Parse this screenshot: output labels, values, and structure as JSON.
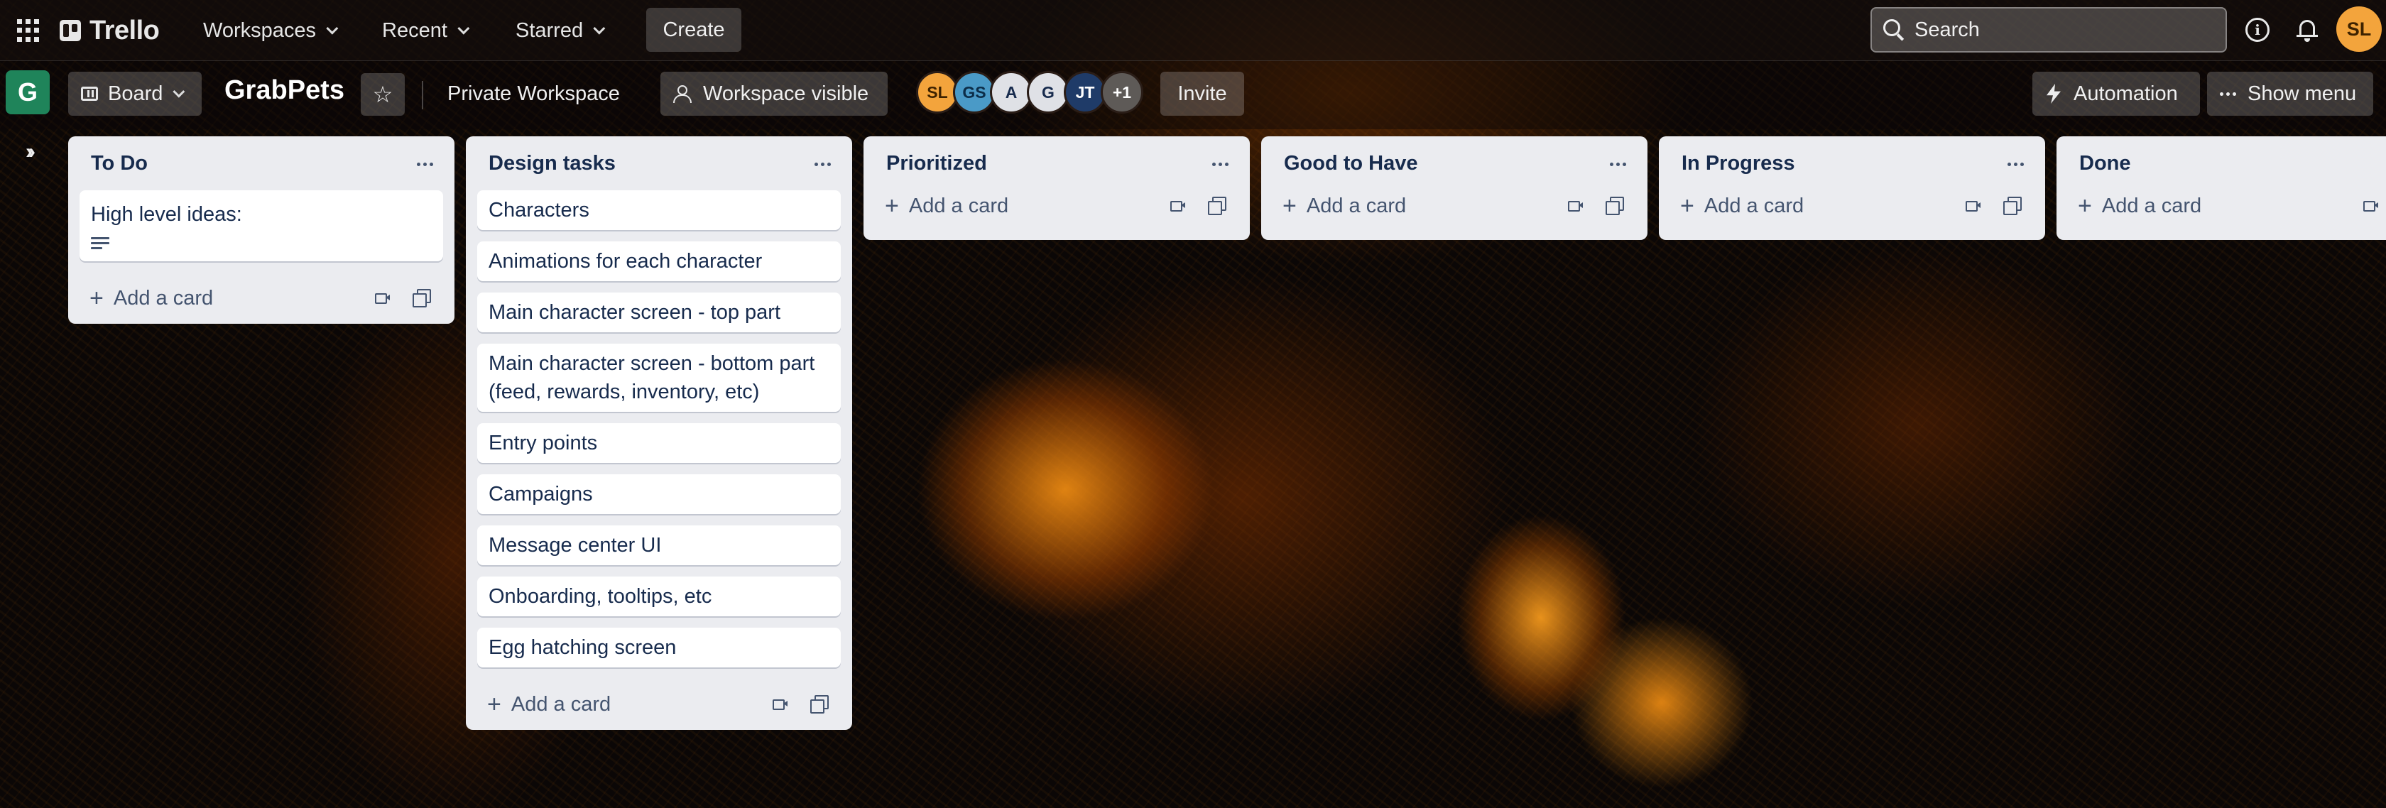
{
  "topbar": {
    "logo": "Trello",
    "nav": [
      "Workspaces",
      "Recent",
      "Starred"
    ],
    "create": "Create",
    "search_placeholder": "Search",
    "user_initials": "SL"
  },
  "board": {
    "workspace_initial": "G",
    "view": "Board",
    "title": "GrabPets",
    "workspace_label": "Private Workspace",
    "visibility": "Workspace visible",
    "members": [
      {
        "initials": "SL",
        "color": "#f3a43c",
        "text": "#3d2200"
      },
      {
        "initials": "GS",
        "color": "#4a9ac7",
        "text": "#0c2d48"
      },
      {
        "initials": "A",
        "color": "#dfe1e6",
        "text": "#172b4d"
      },
      {
        "initials": "G",
        "color": "#dfe1e6",
        "text": "#172b4d"
      },
      {
        "initials": "JT",
        "color": "#1f3b68",
        "text": "#ffffff"
      },
      {
        "initials": "+1",
        "color": "#5e5a57",
        "text": "#ffffff"
      }
    ],
    "invite": "Invite",
    "automation": "Automation",
    "show_menu": "Show menu"
  },
  "lists": [
    {
      "title": "To Do",
      "cards": [
        {
          "text": "High level ideas:",
          "has_description": true
        }
      ],
      "add_label": "Add a card"
    },
    {
      "title": "Design tasks",
      "cards": [
        {
          "text": "Characters"
        },
        {
          "text": "Animations for each character"
        },
        {
          "text": "Main character screen - top part"
        },
        {
          "text": "Main character screen - bottom part (feed, rewards, inventory, etc)"
        },
        {
          "text": "Entry points"
        },
        {
          "text": "Campaigns"
        },
        {
          "text": "Message center UI"
        },
        {
          "text": "Onboarding, tooltips, etc"
        },
        {
          "text": "Egg hatching screen"
        }
      ],
      "add_label": "Add a card"
    },
    {
      "title": "Prioritized",
      "cards": [],
      "add_label": "Add a card"
    },
    {
      "title": "Good to Have",
      "cards": [],
      "add_label": "Add a card"
    },
    {
      "title": "In Progress",
      "cards": [],
      "add_label": "Add a card"
    },
    {
      "title": "Done",
      "cards": [],
      "add_label": "Add a card"
    }
  ]
}
